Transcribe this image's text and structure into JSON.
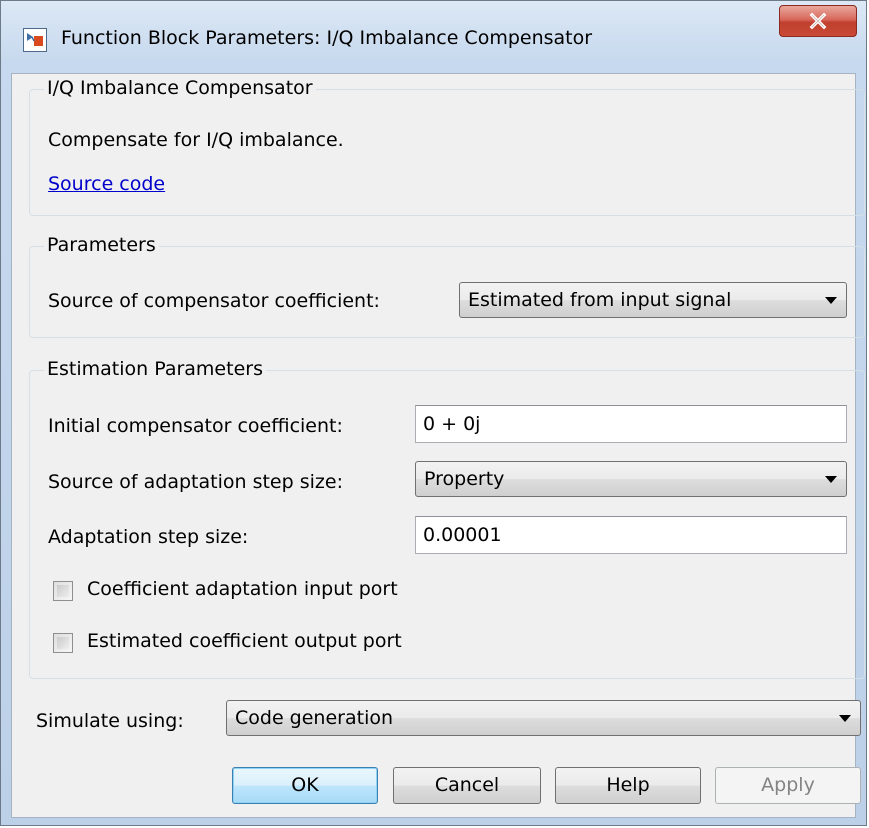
{
  "window": {
    "title": "Function Block Parameters: I/Q Imbalance Compensator",
    "icon": "simulink-block-icon",
    "close_icon": "close-x-icon"
  },
  "description_group": {
    "label": "I/Q Imbalance Compensator",
    "description": "Compensate for I/Q imbalance.",
    "source_link": "Source code"
  },
  "parameters_group": {
    "label": "Parameters",
    "coefficient_source_label": "Source of compensator coefficient:",
    "coefficient_source_value": "Estimated from input signal"
  },
  "estimation_group": {
    "label": "Estimation Parameters",
    "initial_coefficient_label": "Initial compensator coefficient:",
    "initial_coefficient_value": "0 + 0j",
    "step_source_label": "Source of adaptation step size:",
    "step_source_value": "Property",
    "step_size_label": "Adaptation step size:",
    "step_size_value": "0.00001",
    "adaptation_port_label": "Coefficient adaptation input port",
    "adaptation_port_checked": false,
    "output_port_label": "Estimated coefficient output port",
    "output_port_checked": false
  },
  "simulate": {
    "label": "Simulate using:",
    "value": "Code generation"
  },
  "buttons": {
    "ok": "OK",
    "cancel": "Cancel",
    "help": "Help",
    "apply": "Apply"
  },
  "colors": {
    "link": "#0000cc",
    "title_gradient_top": "#dce8f5",
    "close_button": "#c94a36",
    "panel_background": "#f0f0f0",
    "default_button_border": "#3c7fb1"
  }
}
